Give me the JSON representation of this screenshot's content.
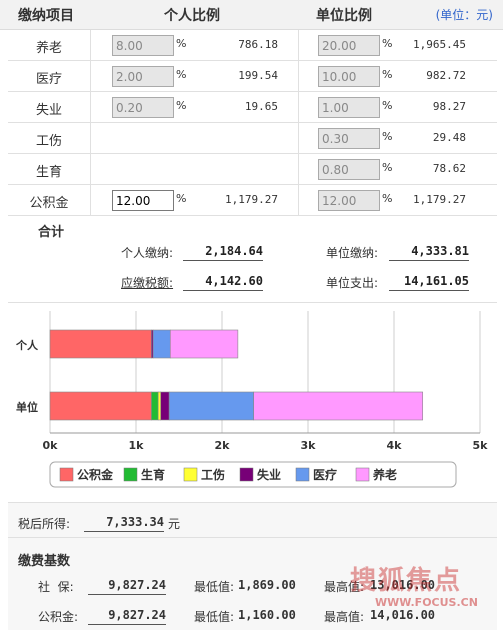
{
  "header": {
    "col_item": "缴纳项目",
    "col_personal": "个人比例",
    "col_company": "单位比例",
    "unit": "(单位：元)"
  },
  "rows": [
    {
      "label": "养老",
      "personal_rate": "8.00",
      "personal_amount": "786.18",
      "company_rate": "20.00",
      "company_amount": "1,965.45"
    },
    {
      "label": "医疗",
      "personal_rate": "2.00",
      "personal_amount": "199.54",
      "company_rate": "10.00",
      "company_amount": "982.72"
    },
    {
      "label": "失业",
      "personal_rate": "0.20",
      "personal_amount": "19.65",
      "company_rate": "1.00",
      "company_amount": "98.27"
    },
    {
      "label": "工伤",
      "personal_rate": "",
      "personal_amount": "",
      "company_rate": "0.30",
      "company_amount": "29.48"
    },
    {
      "label": "生育",
      "personal_rate": "",
      "personal_amount": "",
      "company_rate": "0.80",
      "company_amount": "78.62"
    },
    {
      "label": "公积金",
      "personal_rate": "12.00",
      "personal_amount": "1,179.27",
      "company_rate": "12.00",
      "company_amount": "1,179.27"
    }
  ],
  "pct_sign": "%",
  "summary": {
    "title": "合计",
    "personal_label": "个人缴纳:",
    "personal_value": "2,184.64",
    "company_label": "单位缴纳:",
    "company_value": "4,333.81",
    "tax_label": "应缴税额:",
    "tax_value": "4,142.60",
    "company_total_label": "单位支出:",
    "company_total_value": "14,161.05"
  },
  "chart_data": {
    "type": "bar",
    "orientation": "horizontal",
    "stacked": true,
    "categories": [
      "个人",
      "单位"
    ],
    "series": [
      {
        "name": "公积金",
        "color": "#ff6666",
        "values": [
          1179.27,
          1179.27
        ]
      },
      {
        "name": "生育",
        "color": "#22bb33",
        "values": [
          0,
          78.62
        ]
      },
      {
        "name": "工伤",
        "color": "#ffff33",
        "values": [
          0,
          29.48
        ]
      },
      {
        "name": "失业",
        "color": "#770077",
        "values": [
          19.65,
          98.27
        ]
      },
      {
        "name": "医疗",
        "color": "#6699ee",
        "values": [
          199.54,
          982.72
        ]
      },
      {
        "name": "养老",
        "color": "#ff99ff",
        "values": [
          786.18,
          1965.45
        ]
      }
    ],
    "xlim": [
      0,
      5000
    ],
    "xticks": [
      "0k",
      "1k",
      "2k",
      "3k",
      "4k",
      "5k"
    ],
    "grid": true,
    "legend": "bottom"
  },
  "after_tax": {
    "label": "税后所得:",
    "value": "7,333.34",
    "unit": "元"
  },
  "base": {
    "title": "缴费基数",
    "rows": [
      {
        "label": "社  保:",
        "value": "9,827.24",
        "min_label": "最低值:",
        "min_value": "1,869.00",
        "max_label": "最高值:",
        "max_value": "13,016.00"
      },
      {
        "label": "公积金:",
        "value": "9,827.24",
        "min_label": "最低值:",
        "min_value": "1,160.00",
        "max_label": "最高值:",
        "max_value": "14,016.00"
      }
    ]
  },
  "watermark": {
    "text": "搜狐焦点",
    "url": "WWW.FOCUS.CN"
  }
}
